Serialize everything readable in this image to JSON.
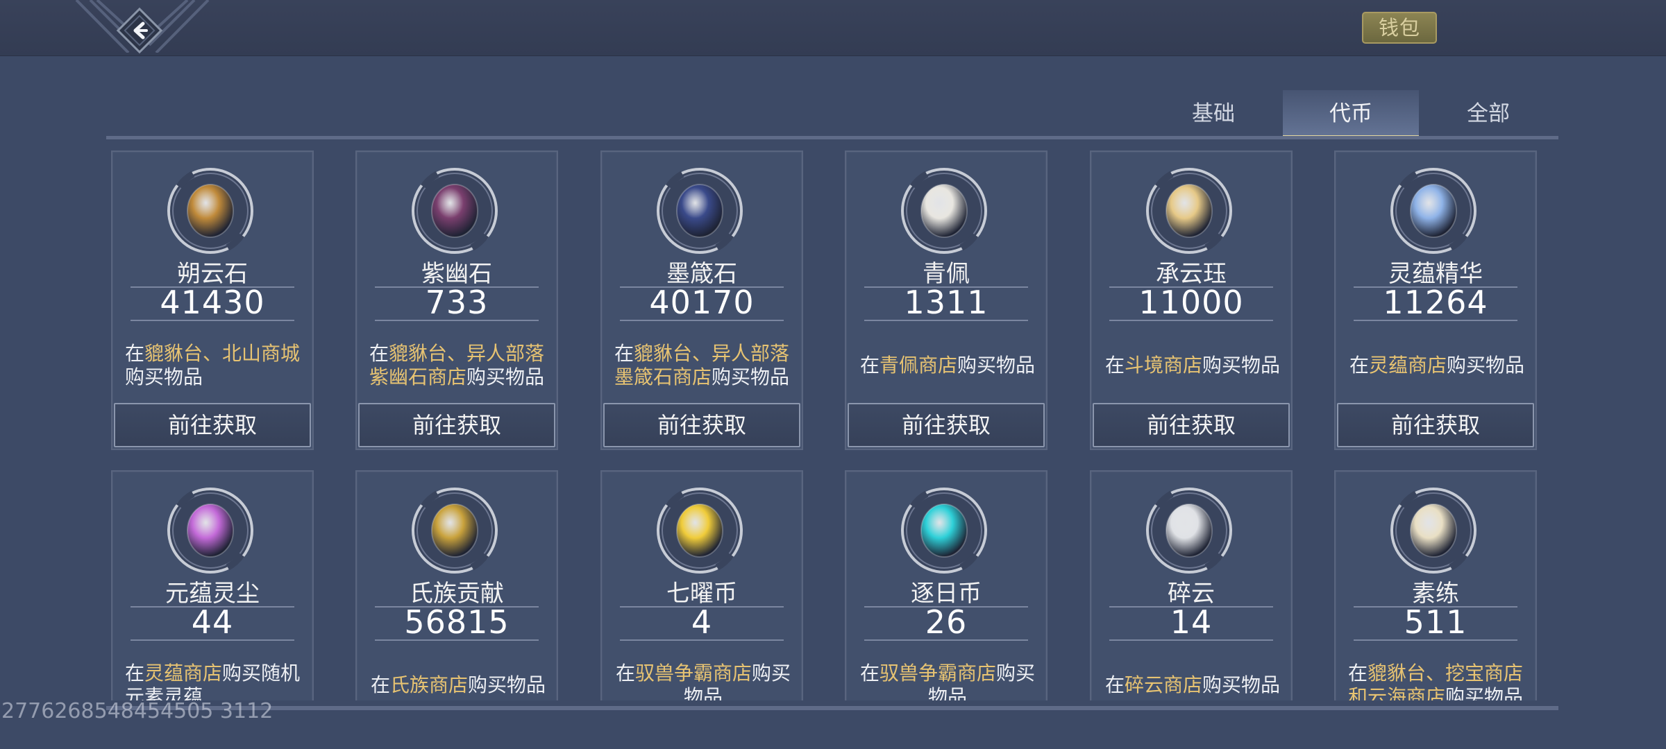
{
  "header": {
    "back_icon": "back-arrow-icon",
    "wallet_label": "钱包"
  },
  "tabs": [
    {
      "label": "基础",
      "active": false
    },
    {
      "label": "代币",
      "active": true
    },
    {
      "label": "全部",
      "active": false
    }
  ],
  "currencies": [
    {
      "name": "朔云石",
      "count": "41430",
      "icon": "shuoyun-stone-icon",
      "desc": [
        {
          "t": "在",
          "hl": false
        },
        {
          "t": "貔貅台、北山商城",
          "hl": true
        },
        {
          "t": "购买物品",
          "hl": false
        }
      ],
      "button": "前往获取",
      "accent": "#c08a3a"
    },
    {
      "name": "紫幽石",
      "count": "733",
      "icon": "ziyou-stone-icon",
      "desc": [
        {
          "t": "在",
          "hl": false
        },
        {
          "t": "貔貅台、异人部落紫幽石商店",
          "hl": true
        },
        {
          "t": "购买物品",
          "hl": false
        }
      ],
      "button": "前往获取",
      "accent": "#7a3f6e"
    },
    {
      "name": "墨箴石",
      "count": "40170",
      "icon": "mozhen-stone-icon",
      "desc": [
        {
          "t": "在",
          "hl": false
        },
        {
          "t": "貔貅台、异人部落墨箴石商店",
          "hl": true
        },
        {
          "t": "购买物品",
          "hl": false
        }
      ],
      "button": "前往获取",
      "accent": "#3a4a8a"
    },
    {
      "name": "青佩",
      "count": "1311",
      "icon": "jade-pendant-icon",
      "desc": [
        {
          "t": "在",
          "hl": false
        },
        {
          "t": "青佩商店",
          "hl": true
        },
        {
          "t": "购买物品",
          "hl": false
        }
      ],
      "button": "前往获取",
      "accent": "#e8e6e0"
    },
    {
      "name": "承云珏",
      "count": "11000",
      "icon": "chengyun-jade-icon",
      "desc": [
        {
          "t": "在",
          "hl": false
        },
        {
          "t": "斗境商店",
          "hl": true
        },
        {
          "t": "购买物品",
          "hl": false
        }
      ],
      "button": "前往获取",
      "accent": "#e6c987"
    },
    {
      "name": "灵蕴精华",
      "count": "11264",
      "icon": "spirit-essence-icon",
      "desc": [
        {
          "t": "在",
          "hl": false
        },
        {
          "t": "灵蕴商店",
          "hl": true
        },
        {
          "t": "购买物品",
          "hl": false
        }
      ],
      "button": "前往获取",
      "accent": "#8fb3e8"
    },
    {
      "name": "元蕴灵尘",
      "count": "44",
      "icon": "spirit-dust-icon",
      "desc": [
        {
          "t": "在",
          "hl": false
        },
        {
          "t": "灵蕴商店",
          "hl": true
        },
        {
          "t": "购买随机元素灵蕴",
          "hl": false
        }
      ],
      "button": "前往获取",
      "accent": "#c36ad8"
    },
    {
      "name": "氏族贡献",
      "count": "56815",
      "icon": "clan-contribution-icon",
      "desc": [
        {
          "t": "在",
          "hl": false
        },
        {
          "t": "氏族商店",
          "hl": true
        },
        {
          "t": "购买物品",
          "hl": false
        }
      ],
      "button": "前往获取",
      "accent": "#c9a23c"
    },
    {
      "name": "七曜币",
      "count": "4",
      "icon": "qiyao-coin-icon",
      "desc": [
        {
          "t": "在",
          "hl": false
        },
        {
          "t": "驭兽争霸商店",
          "hl": true
        },
        {
          "t": "购买物品",
          "hl": false
        }
      ],
      "button": "前往获取",
      "accent": "#f0cc3a"
    },
    {
      "name": "逐日币",
      "count": "26",
      "icon": "zhuri-coin-icon",
      "desc": [
        {
          "t": "在",
          "hl": false
        },
        {
          "t": "驭兽争霸商店",
          "hl": true
        },
        {
          "t": "购买物品",
          "hl": false
        }
      ],
      "button": "前往获取",
      "accent": "#2ed0d8"
    },
    {
      "name": "碎云",
      "count": "14",
      "icon": "cloud-fragment-icon",
      "desc": [
        {
          "t": "在",
          "hl": false
        },
        {
          "t": "碎云商店",
          "hl": true
        },
        {
          "t": "购买物品",
          "hl": false
        }
      ],
      "button": "前往获取",
      "accent": "#e0e2e6"
    },
    {
      "name": "素练",
      "count": "511",
      "icon": "silk-scroll-icon",
      "desc": [
        {
          "t": "在",
          "hl": false
        },
        {
          "t": "貔貅台、挖宝商店和云海商店",
          "hl": true
        },
        {
          "t": "购买物品",
          "hl": false
        }
      ],
      "button": "前往获取",
      "accent": "#e9dfc4"
    }
  ],
  "footer": {
    "uid": "2776268548454505 3112"
  }
}
